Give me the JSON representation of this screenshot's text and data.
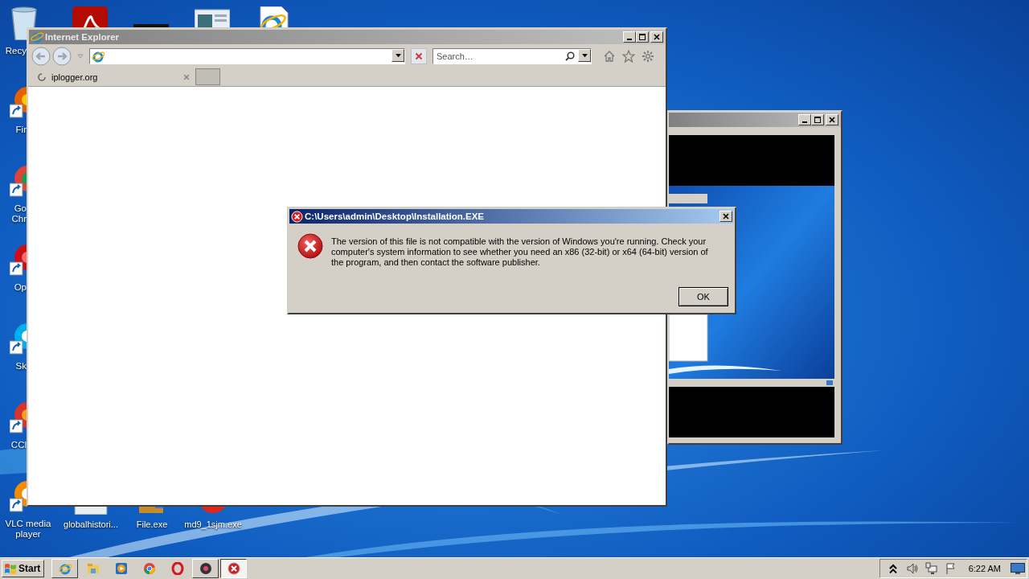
{
  "desktop": {
    "left_icons": [
      {
        "kind": "recycle",
        "label": "Recy"
      },
      {
        "kind": "firefox",
        "label": "Fir"
      },
      {
        "kind": "chrome",
        "label": "Go Chr"
      },
      {
        "kind": "opera",
        "label": "Op"
      },
      {
        "kind": "skype",
        "label": "Sk"
      },
      {
        "kind": "ccleaner",
        "label": "CCl"
      },
      {
        "kind": "vlc",
        "label": "VLC media player"
      }
    ],
    "top_icons": [
      {
        "kind": "acrobat"
      },
      {
        "kind": "dark"
      },
      {
        "kind": "window"
      },
      {
        "kind": "iedoc"
      }
    ],
    "bottom_icons": [
      {
        "kind": "archive",
        "label": "globalhistori..."
      },
      {
        "kind": "setup",
        "label": "File.exe"
      },
      {
        "kind": "redball",
        "label": "md9_1sjm.exe"
      }
    ]
  },
  "browser": {
    "title": "Internet Explorer",
    "search": {
      "placeholder": "Search…"
    },
    "tabs": [
      {
        "label": "iplogger.org",
        "selected": true
      }
    ]
  },
  "dialog": {
    "title": "C:\\Users\\admin\\Desktop\\Installation.EXE",
    "message": "The version of this file is not compatible with the version of Windows you're running. Check your computer's system information to see whether you need an x86 (32-bit) or x64 (64-bit) version of the program, and then contact the software publisher.",
    "button": "OK"
  },
  "taskbar": {
    "start": "Start",
    "apps": [
      {
        "kind": "ie",
        "open": true,
        "selected": false
      },
      {
        "kind": "explorer",
        "open": false,
        "selected": false
      },
      {
        "kind": "media",
        "open": false,
        "selected": false
      },
      {
        "kind": "chrome",
        "open": false,
        "selected": false
      },
      {
        "kind": "opera",
        "open": false,
        "selected": false
      },
      {
        "kind": "record",
        "open": true,
        "selected": false
      },
      {
        "kind": "error",
        "open": true,
        "selected": true
      }
    ],
    "clock": "6:22 AM"
  }
}
